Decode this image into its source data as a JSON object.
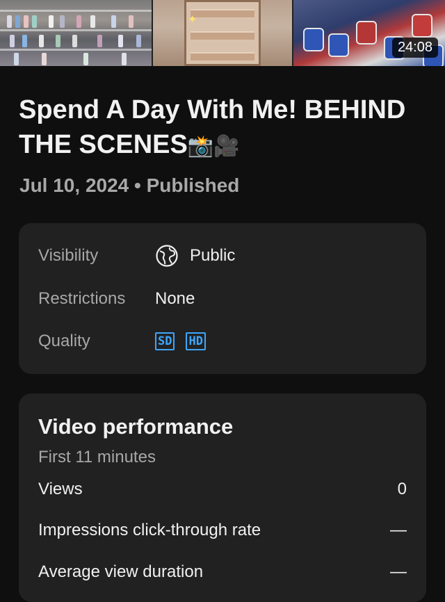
{
  "video": {
    "duration": "24:08",
    "title": "Spend A Day With Me! BEHIND THE SCENES",
    "title_emojis": "📸🎥",
    "date": "Jul 10, 2024",
    "separator": "•",
    "status": "Published"
  },
  "details": {
    "visibility_label": "Visibility",
    "visibility_value": "Public",
    "visibility_icon": "globe-icon",
    "restrictions_label": "Restrictions",
    "restrictions_value": "None",
    "quality_label": "Quality",
    "quality_badges": [
      "SD",
      "HD"
    ]
  },
  "performance": {
    "title": "Video performance",
    "subtitle": "First 11 minutes",
    "metrics": [
      {
        "label": "Views",
        "value": "0"
      },
      {
        "label": "Impressions click-through rate",
        "value": "—"
      },
      {
        "label": "Average view duration",
        "value": "—"
      }
    ]
  },
  "colors": {
    "background": "#0f0f0f",
    "card": "#212121",
    "accent_badge": "#3ea6ff",
    "secondary_text": "#a8a8a8"
  }
}
